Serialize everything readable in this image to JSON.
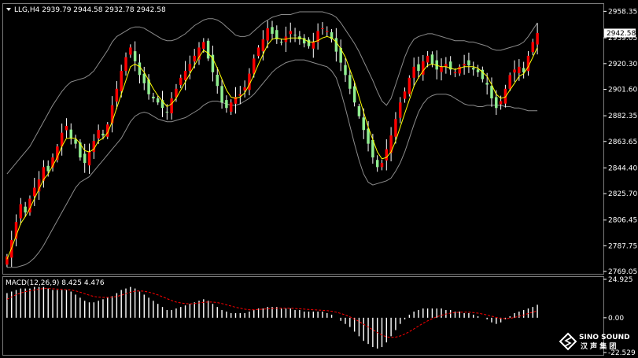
{
  "header": {
    "symbol_line": "LLG,H4  2939.79 2944.58 2932.78 2942.58",
    "macd_label": "MACD(12,26,9) 8.425 4.476"
  },
  "price_axis": {
    "ticks": [
      "2958.35",
      "2939.05",
      "2920.30",
      "2901.60",
      "2882.35",
      "2863.65",
      "2844.40",
      "2825.70",
      "2806.45",
      "2787.75",
      "2769.05"
    ],
    "tick_values": [
      2958.35,
      2939.05,
      2920.3,
      2901.6,
      2882.35,
      2863.65,
      2844.4,
      2825.7,
      2806.45,
      2787.75,
      2769.05
    ],
    "current_price": "2942.58",
    "current_value": 2942.58
  },
  "macd_axis": {
    "ticks": [
      "24.925",
      "0.00",
      "-22.529"
    ],
    "tick_values": [
      24.925,
      0,
      -22.529
    ]
  },
  "logo": {
    "line1": "SINO SOUND",
    "line2": "汉 声 集 团"
  },
  "colors": {
    "bull": "#ff0000",
    "bear": "#90ee90",
    "wick": "#ffffff",
    "ma": "#ffff00",
    "bands": "#8c8c8c",
    "macd_hist": "#ffffff",
    "macd_signal": "#ff0000"
  },
  "chart_data": {
    "type": "candlestick",
    "ylim": [
      2769.05,
      2962
    ],
    "macd_ylim": [
      -22.529,
      24.925
    ],
    "closes": [
      2780,
      2792,
      2805,
      2818,
      2812,
      2822,
      2830,
      2836,
      2845,
      2842,
      2852,
      2860,
      2870,
      2875,
      2866,
      2862,
      2852,
      2848,
      2856,
      2864,
      2872,
      2868,
      2876,
      2890,
      2902,
      2915,
      2925,
      2932,
      2922,
      2912,
      2906,
      2898,
      2895,
      2892,
      2888,
      2885,
      2895,
      2902,
      2910,
      2915,
      2920,
      2926,
      2932,
      2936,
      2924,
      2914,
      2904,
      2892,
      2888,
      2892,
      2896,
      2898,
      2903,
      2913,
      2924,
      2932,
      2938,
      2946,
      2942,
      2938,
      2936,
      2940,
      2944,
      2941,
      2938,
      2935,
      2933,
      2936,
      2944,
      2946,
      2944,
      2938,
      2929,
      2921,
      2912,
      2902,
      2892,
      2882,
      2872,
      2862,
      2852,
      2845,
      2848,
      2858,
      2868,
      2880,
      2892,
      2900,
      2910,
      2918,
      2915,
      2922,
      2926,
      2920,
      2916,
      2918,
      2920,
      2916,
      2914,
      2918,
      2920,
      2919,
      2916,
      2914,
      2909,
      2905,
      2895,
      2888,
      2893,
      2902,
      2912,
      2916,
      2918,
      2914,
      2926,
      2936,
      2942.58
    ],
    "ma": [
      2778,
      2786,
      2795,
      2804,
      2809,
      2815,
      2822,
      2829,
      2836,
      2840,
      2846,
      2852,
      2860,
      2866,
      2866,
      2866,
      2862,
      2857,
      2856,
      2858,
      2864,
      2866,
      2870,
      2878,
      2888,
      2898,
      2908,
      2918,
      2920,
      2918,
      2914,
      2908,
      2902,
      2897,
      2893,
      2889,
      2891,
      2895,
      2901,
      2907,
      2913,
      2919,
      2925,
      2930,
      2928,
      2924,
      2917,
      2909,
      2901,
      2896,
      2895,
      2896,
      2899,
      2905,
      2912,
      2920,
      2927,
      2934,
      2938,
      2939,
      2938,
      2938,
      2939,
      2939,
      2939,
      2938,
      2936,
      2936,
      2937,
      2939,
      2940,
      2939,
      2936,
      2931,
      2925,
      2916,
      2907,
      2896,
      2885,
      2874,
      2865,
      2856,
      2851,
      2852,
      2856,
      2864,
      2874,
      2884,
      2894,
      2904,
      2910,
      2915,
      2919,
      2920,
      2919,
      2918,
      2918,
      2917,
      2916,
      2917,
      2918,
      2918,
      2918,
      2917,
      2914,
      2911,
      2905,
      2898,
      2895,
      2896,
      2901,
      2906,
      2911,
      2913,
      2918,
      2925,
      2932
    ],
    "upper_band": [
      2840,
      2844,
      2848,
      2852,
      2856,
      2860,
      2866,
      2872,
      2878,
      2884,
      2890,
      2895,
      2900,
      2904,
      2907,
      2908,
      2909,
      2910,
      2912,
      2915,
      2920,
      2925,
      2930,
      2936,
      2940,
      2942,
      2944,
      2946,
      2947,
      2947,
      2946,
      2944,
      2942,
      2940,
      2938,
      2937,
      2937,
      2938,
      2940,
      2942,
      2945,
      2948,
      2950,
      2952,
      2953,
      2953,
      2952,
      2950,
      2947,
      2944,
      2941,
      2940,
      2940,
      2941,
      2944,
      2947,
      2950,
      2952,
      2954,
      2955,
      2956,
      2956,
      2956,
      2957,
      2958,
      2958,
      2958,
      2958,
      2958,
      2958,
      2957,
      2956,
      2954,
      2950,
      2945,
      2940,
      2935,
      2929,
      2922,
      2915,
      2908,
      2900,
      2893,
      2890,
      2895,
      2905,
      2915,
      2925,
      2933,
      2938,
      2940,
      2941,
      2942,
      2942,
      2941,
      2940,
      2939,
      2938,
      2937,
      2937,
      2937,
      2936,
      2936,
      2935,
      2934,
      2933,
      2931,
      2930,
      2930,
      2931,
      2932,
      2933,
      2934,
      2936,
      2940,
      2945,
      2950
    ],
    "lower_band": [
      2772,
      2772,
      2772,
      2773,
      2774,
      2776,
      2779,
      2783,
      2788,
      2794,
      2800,
      2806,
      2812,
      2818,
      2824,
      2830,
      2834,
      2836,
      2838,
      2842,
      2846,
      2850,
      2854,
      2858,
      2862,
      2866,
      2872,
      2878,
      2882,
      2884,
      2885,
      2884,
      2882,
      2880,
      2879,
      2878,
      2878,
      2879,
      2880,
      2881,
      2883,
      2885,
      2887,
      2890,
      2892,
      2893,
      2893,
      2892,
      2891,
      2890,
      2890,
      2891,
      2893,
      2895,
      2898,
      2902,
      2906,
      2910,
      2914,
      2917,
      2919,
      2921,
      2922,
      2923,
      2923,
      2923,
      2922,
      2921,
      2920,
      2919,
      2918,
      2915,
      2910,
      2900,
      2888,
      2875,
      2862,
      2850,
      2840,
      2834,
      2832,
      2833,
      2834,
      2835,
      2837,
      2842,
      2848,
      2856,
      2866,
      2876,
      2885,
      2891,
      2895,
      2897,
      2898,
      2898,
      2898,
      2897,
      2895,
      2893,
      2891,
      2890,
      2890,
      2889,
      2889,
      2890,
      2890,
      2890,
      2890,
      2889,
      2889,
      2888,
      2888,
      2887,
      2886,
      2886,
      2886
    ],
    "macd_hist": [
      16,
      17,
      18,
      19,
      19,
      19,
      20,
      20,
      20,
      19,
      18,
      18,
      18,
      18,
      17,
      15,
      13,
      11,
      10,
      10,
      11,
      12,
      13,
      14,
      16,
      18,
      19,
      20,
      19,
      17,
      15,
      13,
      11,
      9,
      7,
      5,
      5,
      6,
      7,
      8,
      9,
      10,
      11,
      12,
      11,
      9,
      7,
      5,
      4,
      3,
      3,
      3,
      3,
      4,
      5,
      6,
      6,
      7,
      7,
      7,
      6,
      6,
      6,
      5,
      5,
      4,
      4,
      4,
      4,
      4,
      3,
      2,
      0,
      -2,
      -4,
      -6,
      -9,
      -12,
      -15,
      -17,
      -19,
      -20,
      -19,
      -16,
      -12,
      -8,
      -4,
      -1,
      2,
      4,
      5,
      6,
      6,
      6,
      6,
      6,
      5,
      5,
      4,
      4,
      3,
      3,
      2,
      1,
      0,
      -1,
      -3,
      -4,
      -3,
      -1,
      1,
      3,
      4,
      5,
      6,
      7,
      8.425
    ],
    "macd_signal": [
      12,
      13.5,
      15,
      16,
      17,
      17.5,
      18,
      18.5,
      19,
      19,
      18.8,
      18.6,
      18.4,
      18.2,
      18,
      17.4,
      16.6,
      15.6,
      14.6,
      13.8,
      13.4,
      13.2,
      13.2,
      13.4,
      13.8,
      14.6,
      15.6,
      16.6,
      17.2,
      17.4,
      17.2,
      16.6,
      15.8,
      14.8,
      13.6,
      12.4,
      11.2,
      10.2,
      9.6,
      9.2,
      9,
      9.2,
      9.6,
      10,
      10.2,
      10.2,
      9.8,
      9.2,
      8.4,
      7.6,
      6.8,
      6.2,
      5.6,
      5.2,
      5.2,
      5.4,
      5.6,
      5.8,
      6,
      6.2,
      6.2,
      6.2,
      6.2,
      6,
      5.8,
      5.6,
      5.4,
      5.2,
      5,
      4.8,
      4.6,
      4.2,
      3.6,
      2.8,
      1.8,
      0.6,
      -0.8,
      -2.4,
      -4.2,
      -6,
      -7.8,
      -9.6,
      -11.2,
      -12.4,
      -12.8,
      -12.6,
      -11.8,
      -10.6,
      -9,
      -7.2,
      -5.4,
      -3.6,
      -2,
      -0.6,
      0.6,
      1.6,
      2.4,
      3,
      3.4,
      3.6,
      3.6,
      3.6,
      3.4,
      3,
      2.4,
      1.8,
      1,
      0.2,
      -0.4,
      -0.6,
      -0.4,
      0.2,
      1,
      1.8,
      2.8,
      3.6,
      4.476
    ]
  }
}
